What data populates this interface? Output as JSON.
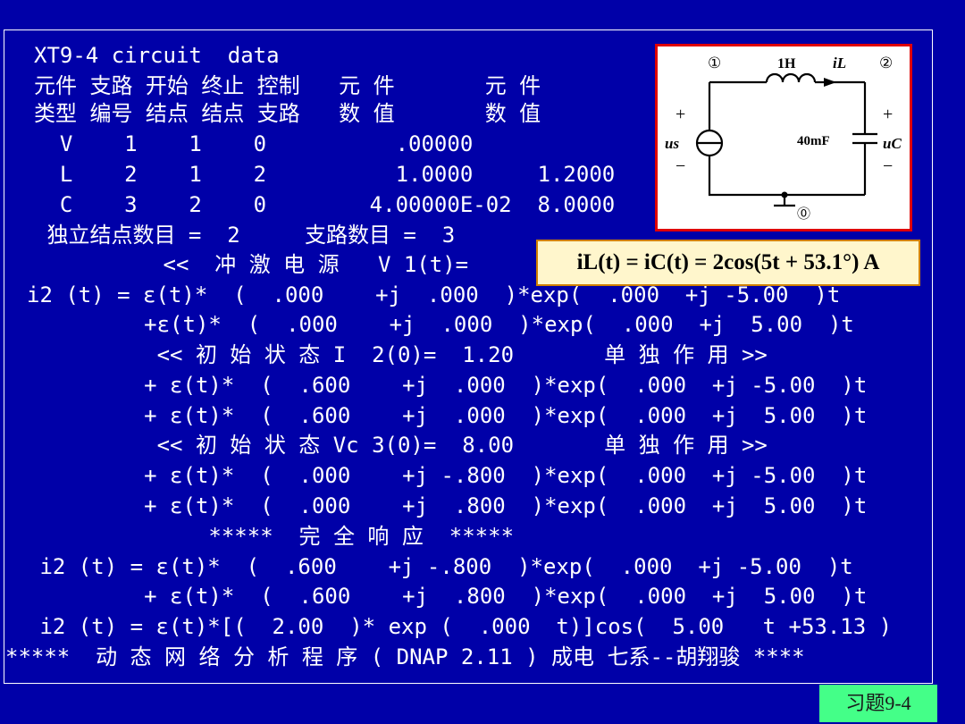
{
  "lines": [
    "XT9-4 circuit  data",
    "元件 支路 开始 终止 控制   元 件       元 件",
    "类型 编号 结点 结点 支路   数 值       数 值",
    "  V    1    1    0          .00000",
    "  L    2    1    2          1.0000     1.2000",
    "  C    3    2    0        4.00000E-02  8.0000",
    " 独立结点数目 =  2     支路数目 =  3",
    "          <<  冲 激 电 源   V 1(t)=",
    "i2 (t) = ε(t)*  (  .000    +j  .000  )*exp(  .000  +j -5.00  )t",
    "       +ε(t)*  (  .000    +j  .000  )*exp(  .000  +j  5.00  )t",
    "        << 初 始 状 态 I  2(0)=  1.20       单 独 作 用 >>",
    "       + ε(t)*  (  .600    +j  .000  )*exp(  .000  +j -5.00  )t",
    "       + ε(t)*  (  .600    +j  .000  )*exp(  .000  +j  5.00  )t",
    "        << 初 始 状 态 Vc 3(0)=  8.00       单 独 作 用 >>",
    "       + ε(t)*  (  .000    +j -.800  )*exp(  .000  +j -5.00  )t",
    "       + ε(t)*  (  .000    +j  .800  )*exp(  .000  +j  5.00  )t",
    "            *****  完 全 响 应  *****",
    " i2 (t) = ε(t)*  (  .600    +j -.800  )*exp(  .000  +j -5.00  )t",
    "       + ε(t)*  (  .600    +j  .800  )*exp(  .000  +j  5.00  )t",
    " i2 (t) = ε(t)*[(  2.00  )* exp (  .000  t)]cos(  5.00   t +53.13 )",
    "*****  动 态 网 络 分 析 程 序 ( DNAP 2.11 ) 成电 七系--胡翔骏 ****"
  ],
  "formula": "iL(t) = iC(t) = 2cos(5t + 53.1°) A",
  "badge": "习题9-4",
  "circuit": {
    "node1": "①",
    "node2": "②",
    "node0": "⓪",
    "inductor": "1H",
    "current": "iL",
    "capacitor": "40mF",
    "source": "us",
    "voltage": "uC",
    "plus": "+",
    "minus": "−"
  },
  "colors": {
    "background": "#0000a8",
    "text": "#ffffff",
    "circuit_border": "#e00000",
    "badge": "#44ff88",
    "formula_bg": "#fff6cc"
  }
}
